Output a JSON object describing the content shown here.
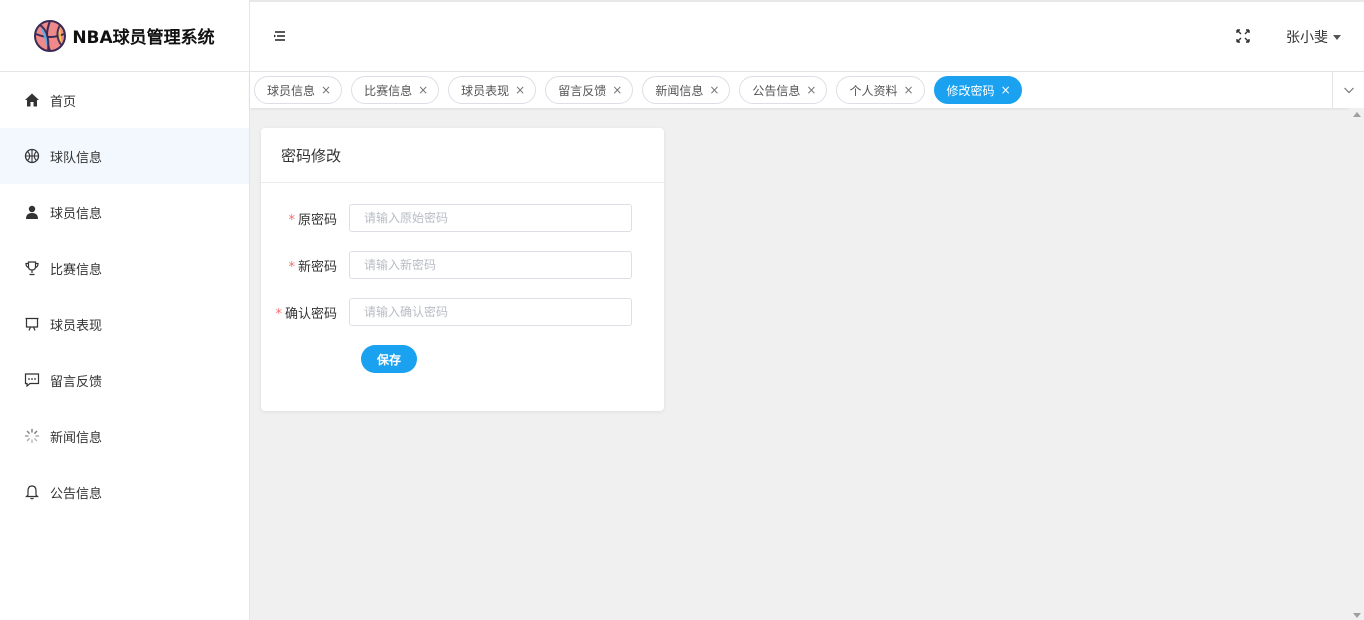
{
  "app": {
    "title": "NBA球员管理系统",
    "logo_icon": "basketball-icon"
  },
  "sidebar": {
    "items": [
      {
        "label": "首页",
        "icon": "home-icon",
        "active": false
      },
      {
        "label": "球队信息",
        "icon": "basketball-outline-icon",
        "active": true
      },
      {
        "label": "球员信息",
        "icon": "user-icon",
        "active": false
      },
      {
        "label": "比赛信息",
        "icon": "trophy-icon",
        "active": false
      },
      {
        "label": "球员表现",
        "icon": "presentation-board-icon",
        "active": false
      },
      {
        "label": "留言反馈",
        "icon": "chat-dots-icon",
        "active": false
      },
      {
        "label": "新闻信息",
        "icon": "loading-spinner-icon",
        "active": false
      },
      {
        "label": "公告信息",
        "icon": "bell-icon",
        "active": false
      }
    ]
  },
  "header": {
    "menu_toggle_icon": "hamburger-icon",
    "fullscreen_icon": "fullscreen-icon",
    "user_name": "张小斐"
  },
  "tabs": [
    {
      "label": "球员信息",
      "active": false
    },
    {
      "label": "比赛信息",
      "active": false
    },
    {
      "label": "球员表现",
      "active": false
    },
    {
      "label": "留言反馈",
      "active": false
    },
    {
      "label": "新闻信息",
      "active": false
    },
    {
      "label": "公告信息",
      "active": false
    },
    {
      "label": "个人资料",
      "active": false
    },
    {
      "label": "修改密码",
      "active": true
    }
  ],
  "tab_close_glyph": "×",
  "card": {
    "title": "密码修改",
    "required_mark": "*",
    "fields": [
      {
        "label": "原密码",
        "placeholder": "请输入原始密码",
        "value": ""
      },
      {
        "label": "新密码",
        "placeholder": "请输入新密码",
        "value": ""
      },
      {
        "label": "确认密码",
        "placeholder": "请输入确认密码",
        "value": ""
      }
    ],
    "save_label": "保存"
  },
  "colors": {
    "accent": "#1aa1f0",
    "required": "#f56c6c",
    "active_menu_bg": "#f2f8fd",
    "content_bg": "#f0f0f0"
  }
}
